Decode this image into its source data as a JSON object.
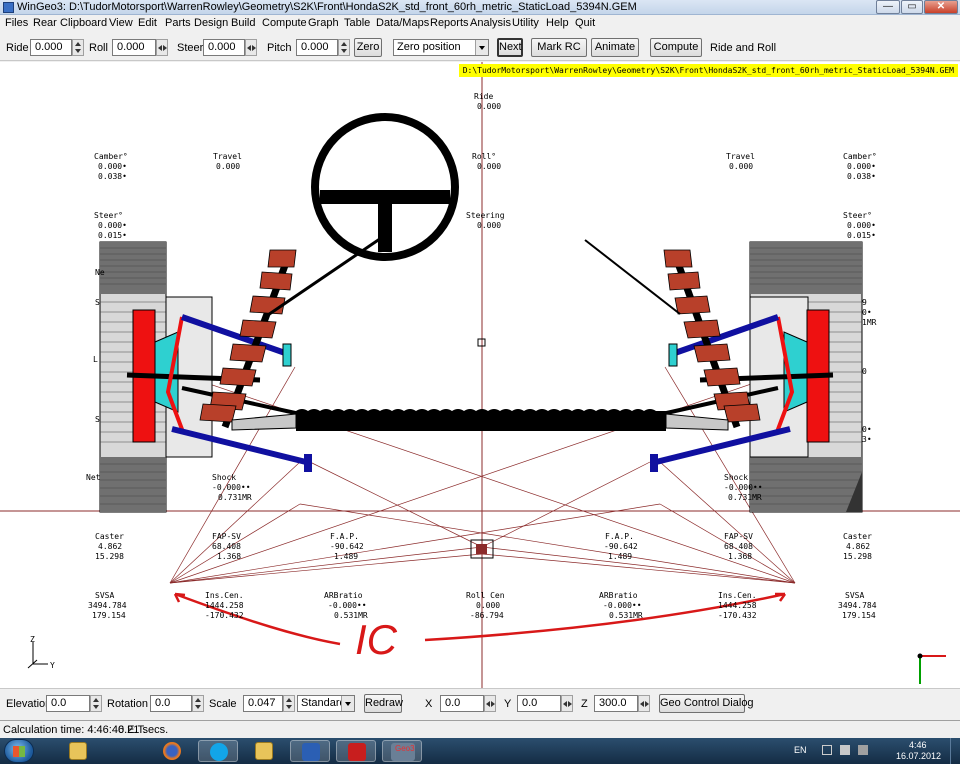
{
  "window": {
    "title": "WinGeo3: D:\\TudorMotorsport\\WarrenRowley\\Geometry\\S2K\\Front\\HondaS2K_std_front_60rh_metric_StaticLoad_5394N.GEM",
    "minimize": "—",
    "maximize": "▭",
    "close": "✕"
  },
  "menu": [
    "Files",
    "Rear",
    "Clipboard",
    "View",
    "Edit",
    "Parts",
    "Design",
    "Build",
    "Compute",
    "Graph",
    "Table",
    "Data/Maps",
    "Reports",
    "Analysis",
    "Utility",
    "Help",
    "Quit"
  ],
  "toolbar": {
    "ride_label": "Ride",
    "ride_value": "0.000",
    "roll_label": "Roll",
    "roll_value": "0.000",
    "steer_label": "Steer",
    "steer_value": "0.000",
    "pitch_label": "Pitch",
    "pitch_value": "0.000",
    "zero_button": "Zero",
    "position_select": "Zero position",
    "next_button": "Next",
    "mark_rc_button": "Mark RC",
    "animate_button": "Animate",
    "compute_button": "Compute",
    "mode_text": "Ride and Roll"
  },
  "canvas": {
    "file_path": "D:\\TudorMotorsport\\WarrenRowley\\Geometry\\S2K\\Front\\HondaS2K_std_front_60rh_metric_StaticLoad_5394N.GEM",
    "readouts": {
      "ride": {
        "label": "Ride",
        "value": "0.000"
      },
      "roll": {
        "label": "Roll°",
        "value": "0.000"
      },
      "steering": {
        "label": "Steering",
        "value": "0.000"
      },
      "left_camber": {
        "label": "Camber°",
        "v1": "0.000•",
        "v2": "0.038•"
      },
      "left_travel": {
        "label": "Travel",
        "value": "0.000"
      },
      "left_steer": {
        "label": "Steer°",
        "v1": "0.000•",
        "v2": "0.015•"
      },
      "right_camber": {
        "label": "Camber°",
        "v1": "0.000•",
        "v2": "0.038•"
      },
      "right_travel": {
        "label": "Travel",
        "value": "0.000"
      },
      "right_steer": {
        "label": "Steer°",
        "v1": "0.000•",
        "v2": "0.015•"
      },
      "left_shock": {
        "label": "Shock",
        "v1": "-0.000••",
        "v2": "0.731MR"
      },
      "right_shock": {
        "label": "Shock",
        "v1": "-0.000••",
        "v2": "0.731MR"
      },
      "left_caster": {
        "label": "Caster",
        "v1": "4.862",
        "v2": "15.298"
      },
      "left_fapsv": {
        "label": "FAP-SV",
        "v1": "68.408",
        "v2": "1.368"
      },
      "left_fap": {
        "label": "F.A.P.",
        "v1": "-90.642",
        "v2": "1.489"
      },
      "right_fap": {
        "label": "F.A.P.",
        "v1": "-90.642",
        "v2": "1.489"
      },
      "right_fapsv": {
        "label": "FAP-SV",
        "v1": "68.408",
        "v2": "1.368"
      },
      "right_caster": {
        "label": "Caster",
        "v1": "4.862",
        "v2": "15.298"
      },
      "left_svsa": {
        "label": "SVSA",
        "v1": "3494.784",
        "v2": "179.154"
      },
      "left_inscen": {
        "label": "Ins.Cen.",
        "v1": "1444.258",
        "v2": "-170.432"
      },
      "left_arb": {
        "label": "ARBratio",
        "v1": "-0.000••",
        "v2": "0.531MR"
      },
      "rollcen": {
        "label": "Roll Cen",
        "v1": "0.000",
        "v2": "-86.794"
      },
      "right_arb": {
        "label": "ARBratio",
        "v1": "-0.000••",
        "v2": "0.531MR"
      },
      "right_inscen": {
        "label": "Ins.Cen.",
        "v1": "1444.258",
        "v2": "-170.432"
      },
      "right_svsa": {
        "label": "SVSA",
        "v1": "3494.784",
        "v2": "179.154"
      }
    },
    "partial": {
      "ne": "Ne",
      "sl": "S",
      "l": "L",
      "s2": "S",
      "net": "Net",
      "r9": "9",
      "r0a": "0•",
      "r1mr": "1MR",
      "r0b": "0",
      "r0c": "0•",
      "r3": "3•"
    },
    "annotation": "IC",
    "axis_z": "Z",
    "axis_y": "Y",
    "colors": {
      "ic_annotation": "#d81818",
      "spring": "#b8402a",
      "arms": "#1010a0",
      "upright": "#ee1111",
      "construction": "#8b2b2b"
    }
  },
  "bottom": {
    "elevation_label": "Elevation",
    "elevation_value": "0.0",
    "rotation_label": "Rotation",
    "rotation_value": "0.0",
    "scale_label": "Scale",
    "scale_value": "0.047",
    "view_select": "Standard",
    "redraw_button": "Redraw",
    "x_label": "X",
    "x_value": "0.0",
    "y_label": "Y",
    "y_value": "0.0",
    "z_label": "Z",
    "z_value": "300.0",
    "geo_dialog_button": "Geo Control Dialog"
  },
  "status": {
    "calc_time": "Calculation time: 4:46:46 E.T.",
    "secs": "0.21 secs."
  },
  "taskbar": {
    "apps": [
      "folder",
      "firefox",
      "skype",
      "outlook",
      "word",
      "acrobat",
      "geo3"
    ],
    "geo_label": "Geo3",
    "lang": "EN",
    "time": "4:46",
    "date": "16.07.2012"
  }
}
